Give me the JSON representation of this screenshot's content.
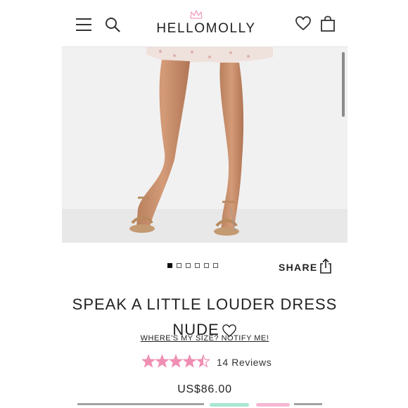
{
  "header": {
    "brand": "HELLOMOLLY"
  },
  "product": {
    "title_line1": "SPEAK A LITTLE LOUDER DRESS",
    "title_line2": "NUDE",
    "size_link": "WHERE'S MY SIZE? NOTIFY ME!",
    "rating": 4.5,
    "rating_max": 5,
    "reviews_label": "14 Reviews",
    "price": "US$86.00"
  },
  "gallery": {
    "image_count": 6,
    "active_index": 0
  },
  "share": {
    "label": "SHARE"
  },
  "colors": {
    "star": "#f08fb4",
    "text": "#222222",
    "accent_mint": "#a8e8d2",
    "accent_pink": "#f6b7d2"
  },
  "icons": {
    "menu": "hamburger-icon",
    "search": "search-icon",
    "wishlist": "heart-icon",
    "cart": "shopping-bag-icon",
    "share": "share-icon",
    "logo_mark": "crown-icon"
  }
}
